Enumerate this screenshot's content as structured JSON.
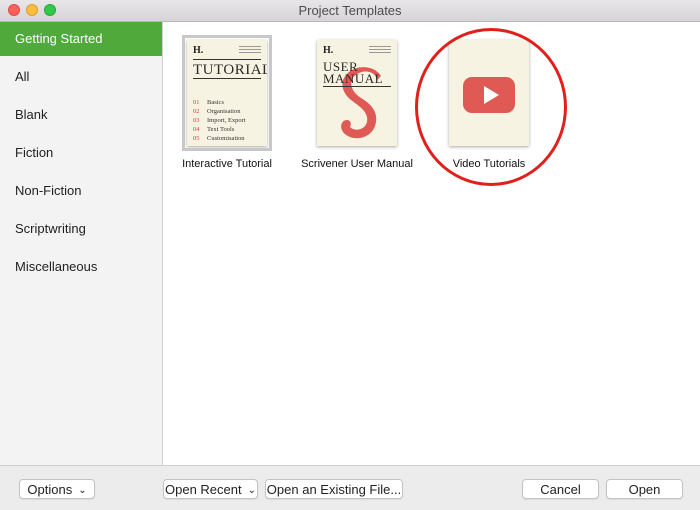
{
  "window": {
    "title": "Project Templates"
  },
  "sidebar": {
    "items": [
      {
        "label": "Getting Started",
        "selected": true
      },
      {
        "label": "All"
      },
      {
        "label": "Blank"
      },
      {
        "label": "Fiction"
      },
      {
        "label": "Non-Fiction"
      },
      {
        "label": "Scriptwriting"
      },
      {
        "label": "Miscellaneous"
      }
    ]
  },
  "templates": [
    {
      "label": "Interactive Tutorial",
      "cover": {
        "mark": "H.",
        "title": "TUTORIAL",
        "toc": [
          {
            "num": "01",
            "text": "Basics"
          },
          {
            "num": "02",
            "text": "Organisation"
          },
          {
            "num": "03",
            "text": "Import, Export"
          },
          {
            "num": "04",
            "text": "Text Tools"
          },
          {
            "num": "05",
            "text": "Customisation"
          }
        ]
      }
    },
    {
      "label": "Scrivener User Manual",
      "cover": {
        "mark": "H.",
        "title_line1": "USER",
        "title_line2": "MANUAL",
        "glyph": "S"
      }
    },
    {
      "label": "Video Tutorials",
      "cover": {
        "icon": "play-icon"
      }
    }
  ],
  "bottom": {
    "options": "Options",
    "open_recent": "Open Recent",
    "open_existing": "Open an Existing File...",
    "cancel": "Cancel",
    "open": "Open"
  },
  "colors": {
    "accent": "#4fa93b",
    "highlight": "#e0201b",
    "youtube_red": "#e05a55",
    "cover_bg": "#f7f3e2"
  }
}
